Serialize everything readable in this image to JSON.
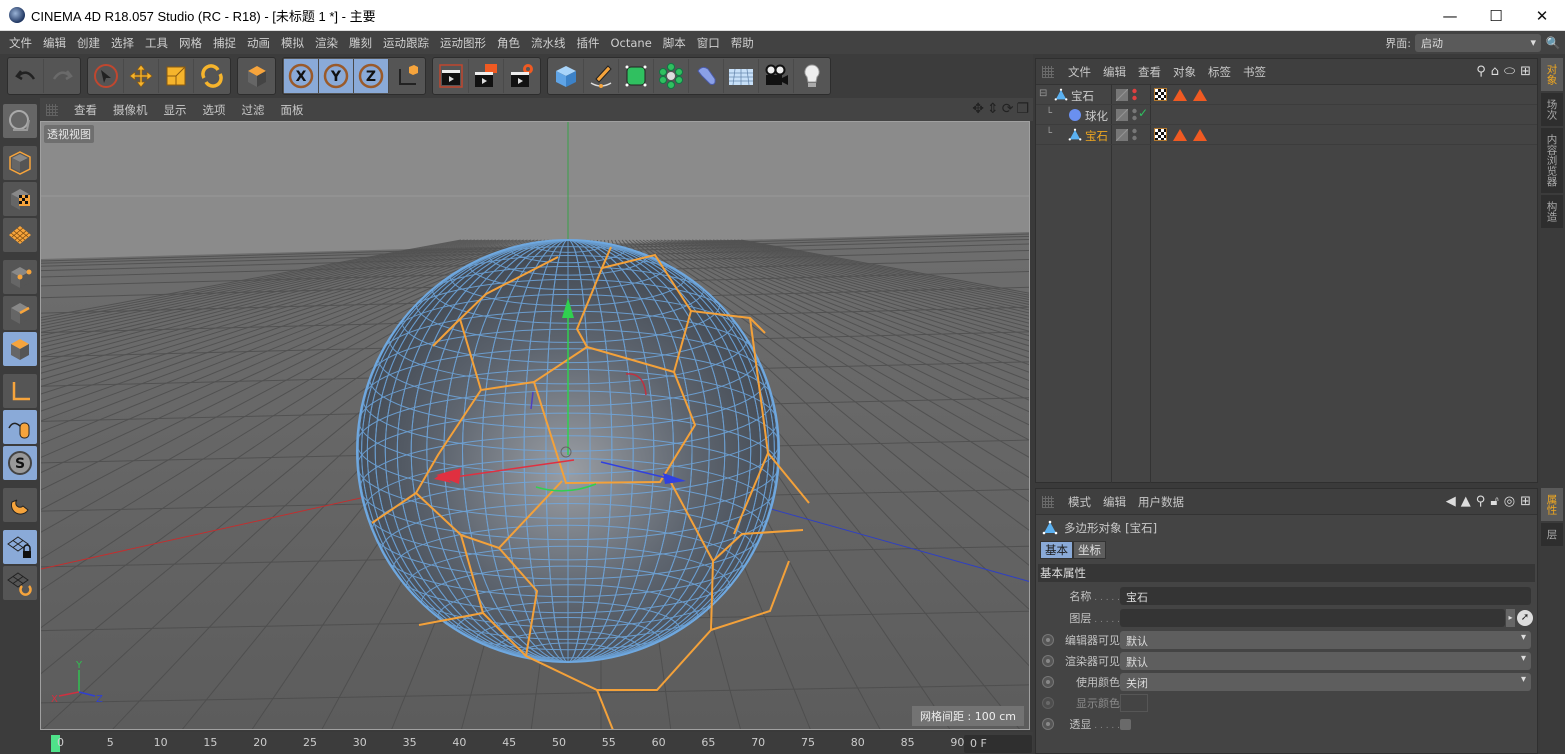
{
  "window": {
    "title": "CINEMA 4D R18.057 Studio (RC - R18) - [未标题 1 *] - 主要",
    "controls": {
      "minimize": "—",
      "maximize": "☐",
      "close": "✕"
    }
  },
  "menubar": {
    "items": [
      "文件",
      "编辑",
      "创建",
      "选择",
      "工具",
      "网格",
      "捕捉",
      "动画",
      "模拟",
      "渲染",
      "雕刻",
      "运动跟踪",
      "运动图形",
      "角色",
      "流水线",
      "插件",
      "Octane",
      "脚本",
      "窗口",
      "帮助"
    ],
    "layout_label": "界面:",
    "layout_value": "启动"
  },
  "toolbar": {
    "groups": [
      [
        "undo-icon",
        "redo-icon"
      ],
      [
        "live-selection-icon",
        "move-icon",
        "scale-icon",
        "rotate-icon"
      ],
      [
        "recent-object-icon"
      ],
      [
        "lock-x-icon",
        "lock-y-icon",
        "lock-z-icon",
        "coordinate-system-icon"
      ],
      [
        "render-view-icon",
        "render-to-picture-viewer-icon",
        "render-settings-icon"
      ],
      [
        "cube-icon",
        "pen-icon",
        "subdivision-surface-icon",
        "cloner-icon",
        "bend-deformer-icon",
        "floor-icon",
        "camera-icon",
        "light-icon"
      ]
    ],
    "selected": [
      "live-selection-icon",
      "lock-x-icon",
      "lock-y-icon",
      "lock-z-icon"
    ]
  },
  "leftbar": {
    "tools": [
      "make-editable-icon",
      "texture-mode-icon",
      "workplane-mode-icon",
      "points-mode-icon",
      "edges-mode-icon",
      "polygons-mode-icon",
      "axis-mode-icon",
      "tweak-mode-icon",
      "solo-icon",
      "snap-icon",
      "workplane-lock-icon",
      "workplane-align-icon"
    ],
    "selected": [
      "polygons-mode-icon",
      "tweak-mode-icon",
      "solo-icon",
      "workplane-lock-icon"
    ]
  },
  "viewport": {
    "menu": [
      "查看",
      "摄像机",
      "显示",
      "选项",
      "过滤",
      "面板"
    ],
    "label": "透视视图",
    "grid_spacing": "网格间距 : 100 cm",
    "axis_labels": {
      "x": "X",
      "y": "Y",
      "z": "Z"
    }
  },
  "timeline": {
    "ticks": [
      "0",
      "5",
      "10",
      "15",
      "20",
      "25",
      "30",
      "35",
      "40",
      "45",
      "50",
      "55",
      "60",
      "65",
      "70",
      "75",
      "80",
      "85",
      "90"
    ],
    "current_frame": "0 F"
  },
  "object_manager": {
    "menu": [
      "文件",
      "编辑",
      "查看",
      "对象",
      "标签",
      "书签"
    ],
    "objects": [
      {
        "name": "宝石",
        "type": "polygon",
        "level": 0,
        "active": false,
        "tags": [
          "checker",
          "tri",
          "tri"
        ],
        "status": "red"
      },
      {
        "name": "球化",
        "type": "spherify",
        "level": 1,
        "active": false,
        "tags": [],
        "status": "check"
      },
      {
        "name": "宝石",
        "type": "polygon",
        "level": 1,
        "active": true,
        "tags": [
          "checker",
          "tri",
          "tri"
        ],
        "status": "gray"
      }
    ]
  },
  "side_tabs": {
    "top": [
      "对象",
      "场次",
      "内容浏览器",
      "构造"
    ],
    "bottom": [
      "属性",
      "层"
    ]
  },
  "attribute_manager": {
    "menu": [
      "模式",
      "编辑",
      "用户数据"
    ],
    "object_title": "多边形对象 [宝石]",
    "tabs": [
      "基本",
      "坐标"
    ],
    "active_tab": "基本",
    "section": "基本属性",
    "fields": {
      "name_label": "名称",
      "name_value": "宝石",
      "layer_label": "图层",
      "layer_value": "",
      "editor_visible_label": "编辑器可见",
      "editor_visible_value": "默认",
      "render_visible_label": "渲染器可见",
      "render_visible_value": "默认",
      "use_color_label": "使用颜色",
      "use_color_value": "关闭",
      "display_color_label": "显示颜色",
      "xray_label": "透显"
    }
  },
  "colors": {
    "accent_selected": "#8aaad8",
    "highlight_orange": "#f0a820",
    "wire_blue": "#6fa8e0",
    "edge_orange": "#f3a13a",
    "frame_cursor": "#4fe28a"
  }
}
